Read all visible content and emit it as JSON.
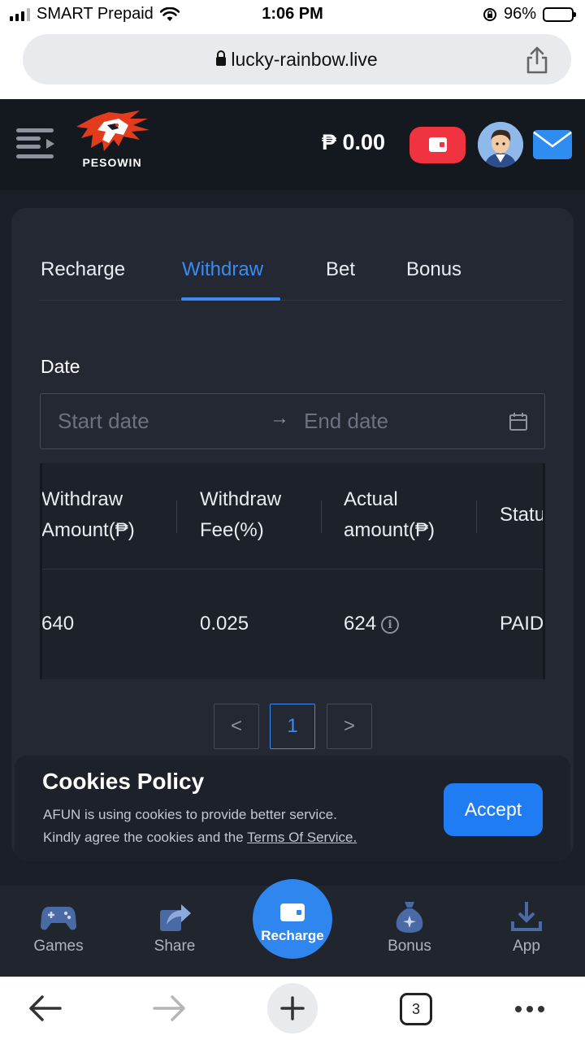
{
  "status_bar": {
    "carrier": "SMART Prepaid",
    "time": "1:06 PM",
    "battery_percent": "96%",
    "battery_level": 0.96
  },
  "browser": {
    "url": "lucky-rainbow.live",
    "tab_count": "3"
  },
  "header": {
    "logo_text": "PESOWIN",
    "balance": "₱ 0.00",
    "wallet_color": "#ef3340",
    "mail_color": "#2f8cf0"
  },
  "tabs": [
    {
      "label": "Recharge",
      "active": false
    },
    {
      "label": "Withdraw",
      "active": true
    },
    {
      "label": "Bet",
      "active": false
    },
    {
      "label": "Bonus",
      "active": false
    }
  ],
  "date_filter": {
    "label": "Date",
    "start_placeholder": "Start date",
    "end_placeholder": "End date"
  },
  "table": {
    "headers": [
      [
        "Withdraw",
        "Amount(₱)"
      ],
      [
        "Withdraw",
        "Fee(%)"
      ],
      [
        "Actual",
        "amount(₱)"
      ],
      [
        "Statu"
      ]
    ],
    "rows": [
      {
        "withdraw_amount": "640",
        "fee": "0.025",
        "actual_amount": "624",
        "status": "PAID"
      }
    ]
  },
  "pagination": {
    "current_page": "1",
    "prev": "<",
    "next": ">"
  },
  "cookies": {
    "title": "Cookies Policy",
    "line1": "AFUN is using cookies to provide better service.",
    "line2_prefix": "Kindly agree the cookies and the ",
    "terms_link": "Terms Of Service.",
    "accept_label": "Accept"
  },
  "bottom_nav": {
    "games": "Games",
    "share": "Share",
    "recharge": "Recharge",
    "bonus": "Bonus",
    "app": "App"
  },
  "accent_color": "#3a8bf2"
}
